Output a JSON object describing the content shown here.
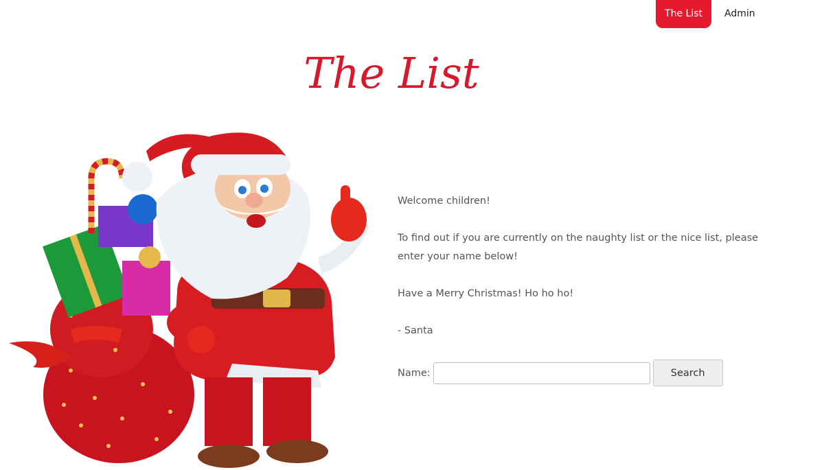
{
  "nav": {
    "items": [
      {
        "label": "The List",
        "active": true
      },
      {
        "label": "Admin",
        "active": false
      }
    ]
  },
  "header": {
    "title": "The List"
  },
  "main": {
    "paragraphs": [
      "Welcome children!",
      "To find out if you are currently on the naughty list or the nice list, please enter your name below!",
      "Have a Merry Christmas! Ho ho ho!",
      "- Santa"
    ],
    "form": {
      "name_label": "Name:",
      "name_value": "",
      "name_placeholder": "",
      "search_label": "Search"
    }
  },
  "colors": {
    "accent": "#e6192e",
    "text": "#555555"
  },
  "illustration": {
    "name": "santa-with-gift-sack"
  }
}
